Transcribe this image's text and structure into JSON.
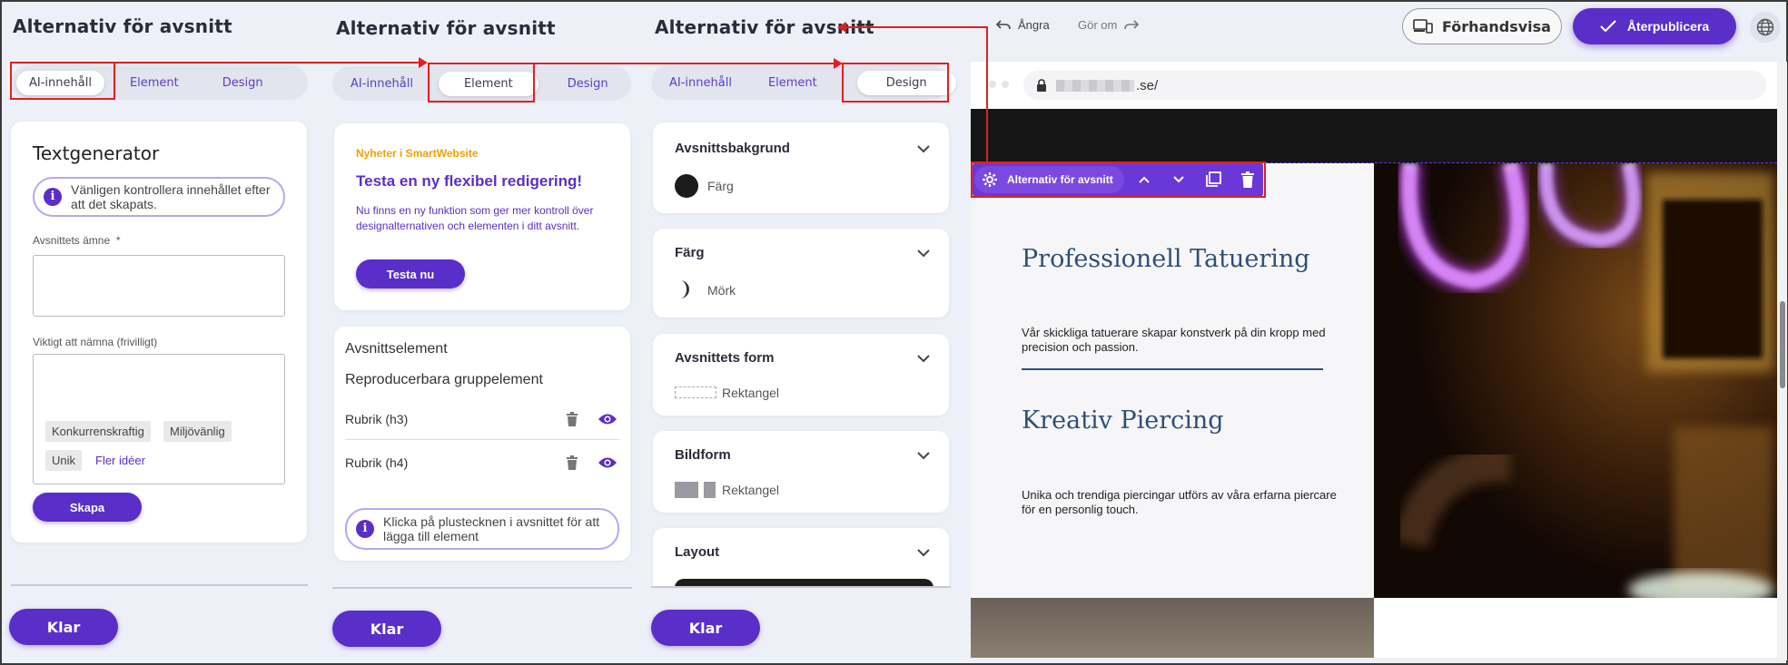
{
  "panels": {
    "panel1": {
      "title": "Alternativ för avsnitt",
      "tabs": [
        "AI-innehåll",
        "Element",
        "Design"
      ],
      "heading": "Textgenerator",
      "info": "Vänligen kontrollera innehållet efter att det skapats.",
      "field1_label": "Avsnittets ämne",
      "required_mark": "*",
      "field2_label": "Viktigt att nämna (frivilligt)",
      "chips": [
        "Konkurrenskraftig",
        "Miljövänlig",
        "Unik"
      ],
      "more_ideas": "Fler idéer",
      "create_button": "Skapa",
      "done_button": "Klar"
    },
    "panel2": {
      "title": "Alternativ för avsnitt",
      "tabs": [
        "AI-innehåll",
        "Element",
        "Design"
      ],
      "news_tag": "Nyheter i SmartWebsite",
      "news_title": "Testa en ny flexibel redigering!",
      "news_body": "Nu finns en ny funktion som ger mer kontroll över designalternativen och elementen i ditt avsnitt.",
      "try_button": "Testa nu",
      "section_elements": "Avsnittselement",
      "repeatable": "Reproducerbara gruppelement",
      "rows": [
        "Rubrik (h3)",
        "Rubrik (h4)"
      ],
      "hint": "Klicka på plustecknen i avsnittet för att lägga till element",
      "done_button": "Klar"
    },
    "panel3": {
      "title": "Alternativ för avsnitt",
      "tabs": [
        "AI-innehåll",
        "Element",
        "Design"
      ],
      "accordions": [
        {
          "title": "Avsnittsbakgrund",
          "value": "Färg"
        },
        {
          "title": "Färg",
          "value": "Mörk"
        },
        {
          "title": "Avsnittets form",
          "value": "Rektangel"
        },
        {
          "title": "Bildform",
          "value": "Rektangel"
        },
        {
          "title": "Layout",
          "value": ""
        }
      ],
      "done_button": "Klar"
    }
  },
  "topbar": {
    "undo": "Ångra",
    "redo": "Gör om",
    "preview": "Förhandsvisa",
    "republish": "Återpublicera"
  },
  "preview": {
    "url": ".se/",
    "toolbar_label": "Alternativ för avsnitt",
    "heading1": "Professionell Tatuering",
    "text1": "Vår skickliga tatuerare skapar konstverk på din kropp med precision och passion.",
    "heading2": "Kreativ Piercing",
    "text2": "Unika och trendiga piercingar utförs av våra erfarna piercare för en personlig touch."
  },
  "colors": {
    "accent": "#5a2ec9",
    "highlight": "#e02020",
    "heading_blue": "#2f4f75",
    "news_orange": "#f0a000"
  }
}
